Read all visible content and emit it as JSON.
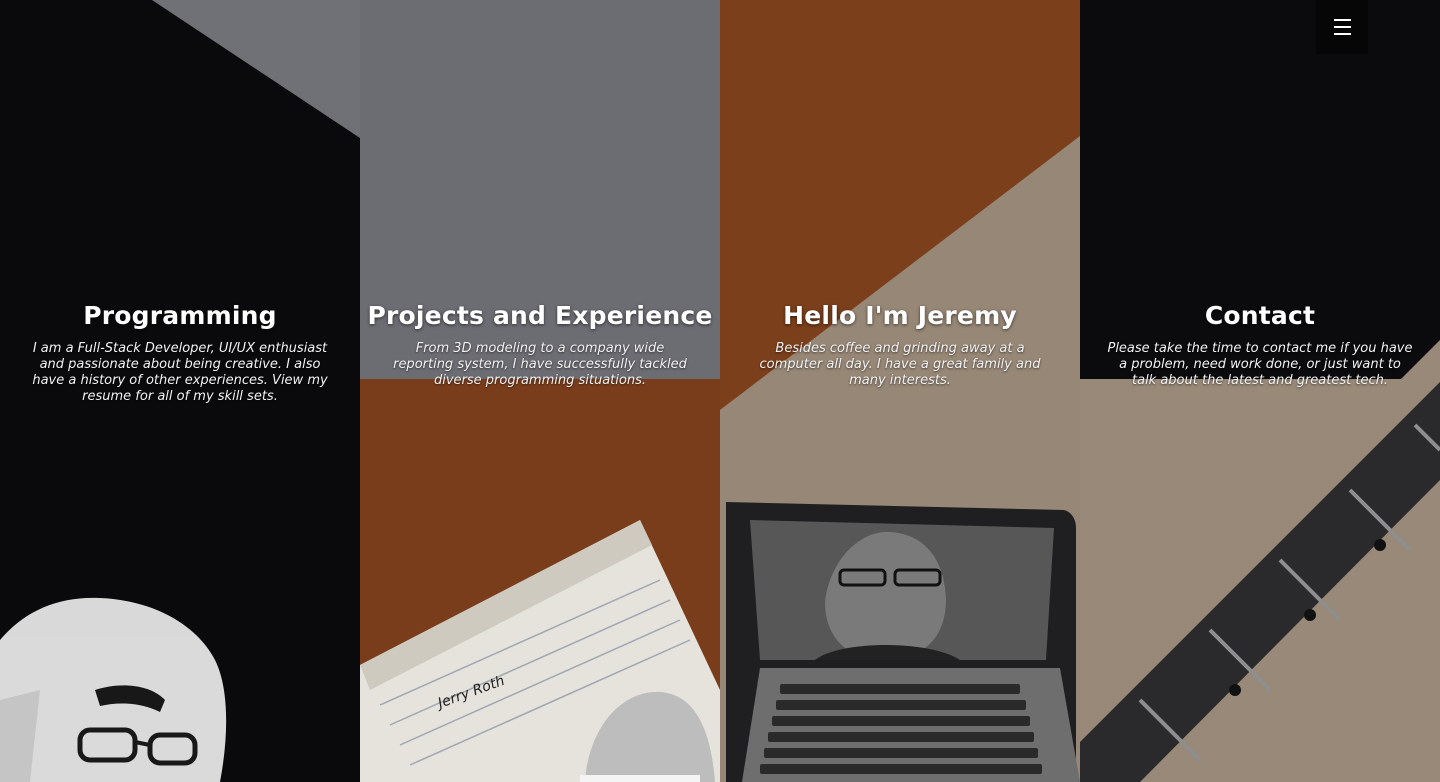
{
  "menu": {
    "icon": "hamburger-icon"
  },
  "panels": [
    {
      "id": "programming",
      "title": "Programming",
      "text": "I am a Full-Stack Developer, UI/UX enthusiast and passionate about being creative. I also have a history of other experiences. View my resume for all of my skill sets."
    },
    {
      "id": "projects",
      "title": "Projects and Experience",
      "text": "From 3D modeling to a company wide reporting system, I have successfully tackled diverse programming situations."
    },
    {
      "id": "about",
      "title": "Hello I'm Jeremy",
      "text": "Besides coffee and grinding away at a computer all day. I have a great family and many interests."
    },
    {
      "id": "contact",
      "title": "Contact",
      "text": "Please take the time to contact me if you have a problem, need work done, or just want to talk about the latest and greatest tech."
    }
  ],
  "notepad_signature": "Jerry Roth",
  "colors": {
    "dark": "#0b0b0d",
    "gray": "#6b6b72",
    "rust": "#7c3f1d",
    "tan": "#9a8a7a"
  }
}
